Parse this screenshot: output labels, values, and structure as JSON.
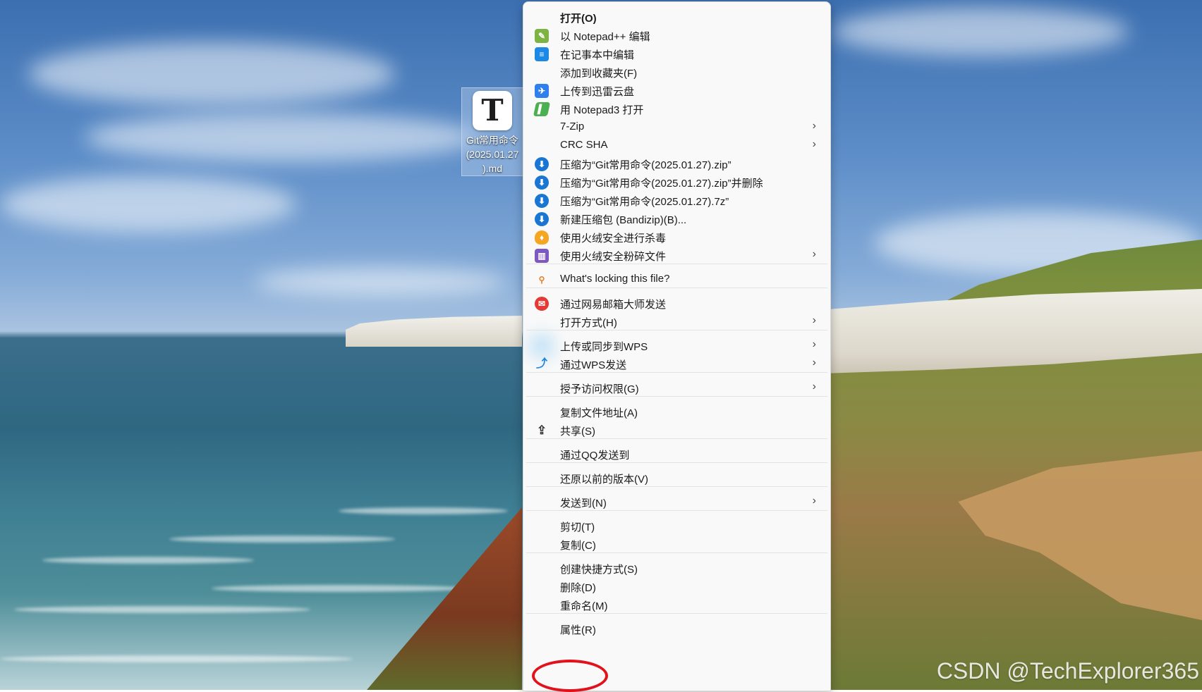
{
  "desktop_icon": {
    "glyph": "T",
    "caption": "Git常用命令\n(2025.01.27\n).md"
  },
  "context_menu": {
    "items": [
      {
        "label": "打开(O)",
        "icon": "none",
        "bold": true
      },
      {
        "label": "以 Notepad++ 编辑",
        "icon": "notepadpp-icon"
      },
      {
        "label": "在记事本中编辑",
        "icon": "notepad-icon"
      },
      {
        "label": "添加到收藏夹(F)",
        "icon": "none"
      },
      {
        "label": "上传到迅雷云盘",
        "icon": "xunlei-icon"
      },
      {
        "label": "用 Notepad3 打开",
        "icon": "notepad3-icon"
      },
      {
        "label": "7-Zip",
        "icon": "none",
        "submenu": true
      },
      {
        "label": "CRC SHA",
        "icon": "none",
        "submenu": true
      },
      {
        "label": "压缩为“Git常用命令(2025.01.27).zip”",
        "icon": "bandizip-icon"
      },
      {
        "label": "压缩为“Git常用命令(2025.01.27).zip”并删除",
        "icon": "bandizip-icon"
      },
      {
        "label": "压缩为“Git常用命令(2025.01.27).7z”",
        "icon": "bandizip-icon"
      },
      {
        "label": "新建压缩包 (Bandizip)(B)...",
        "icon": "bandizip-icon"
      },
      {
        "label": "使用火绒安全进行杀毒",
        "icon": "huorong-icon"
      },
      {
        "label": "使用火绒安全粉碎文件",
        "icon": "shredder-icon",
        "submenu": true
      },
      {
        "label": "What's locking this file?",
        "icon": "lock-search-icon"
      },
      {
        "label": "通过网易邮箱大师发送",
        "icon": "netease-mail-icon"
      },
      {
        "label": "打开方式(H)",
        "icon": "none",
        "submenu": true
      },
      {
        "label": "上传或同步到WPS",
        "icon": "wps-cloud-icon",
        "submenu": true
      },
      {
        "label": "通过WPS发送",
        "icon": "wps-send-icon",
        "submenu": true
      },
      {
        "label": "授予访问权限(G)",
        "icon": "none",
        "submenu": true
      },
      {
        "label": "复制文件地址(A)",
        "icon": "none"
      },
      {
        "label": "共享(S)",
        "icon": "share-icon"
      },
      {
        "label": "通过QQ发送到",
        "icon": "none"
      },
      {
        "label": "还原以前的版本(V)",
        "icon": "none"
      },
      {
        "label": "发送到(N)",
        "icon": "none",
        "submenu": true
      },
      {
        "label": "剪切(T)",
        "icon": "none"
      },
      {
        "label": "复制(C)",
        "icon": "none"
      },
      {
        "label": "创建快捷方式(S)",
        "icon": "none"
      },
      {
        "label": "删除(D)",
        "icon": "none"
      },
      {
        "label": "重命名(M)",
        "icon": "none"
      },
      {
        "label": "属性(R)",
        "icon": "none",
        "highlighted": true
      }
    ],
    "chevron": "›"
  },
  "annotation": {
    "color": "#e2111b",
    "marks": "属性(R)"
  },
  "watermark": "CSDN @TechExplorer365"
}
